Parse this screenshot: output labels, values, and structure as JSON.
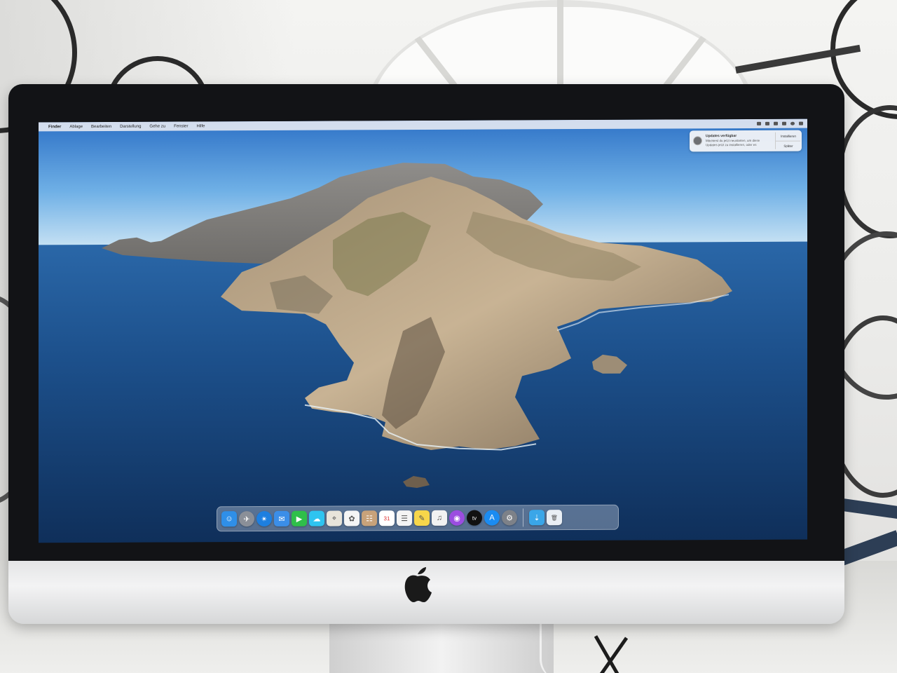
{
  "menubar": {
    "items": [
      "Finder",
      "Ablage",
      "Bearbeiten",
      "Darstellung",
      "Gehe zu",
      "Fenster",
      "Hilfe"
    ]
  },
  "notification": {
    "title": "Updates verfügbar",
    "body": "Möchtest du jetzt neustarten, um diese Updates jetzt zu installieren, oder es",
    "install_label": "Installieren",
    "later_label": "Später"
  },
  "dock": {
    "apps": [
      {
        "name": "finder-icon",
        "color": "#2f8fe8",
        "glyph": "☺"
      },
      {
        "name": "launchpad-icon",
        "color": "#8a8f98",
        "glyph": "✈"
      },
      {
        "name": "safari-icon",
        "color": "#1d7fe0",
        "glyph": "✴"
      },
      {
        "name": "mail-icon",
        "color": "#3b8ee8",
        "glyph": "✉"
      },
      {
        "name": "facetime-icon",
        "color": "#2fbf4a",
        "glyph": "▶"
      },
      {
        "name": "messages-icon",
        "color": "#2ec4f0",
        "glyph": "☁"
      },
      {
        "name": "maps-icon",
        "color": "#e8e4da",
        "glyph": "⌖"
      },
      {
        "name": "photos-icon",
        "color": "#f5f5f5",
        "glyph": "✿"
      },
      {
        "name": "contacts-icon",
        "color": "#c8a27a",
        "glyph": "☷"
      },
      {
        "name": "calendar-icon",
        "color": "#ffffff",
        "glyph": "31"
      },
      {
        "name": "reminders-icon",
        "color": "#f4f4f4",
        "glyph": "☰"
      },
      {
        "name": "notes-icon",
        "color": "#f7d64a",
        "glyph": "✎"
      },
      {
        "name": "music-icon",
        "color": "#f2f2f2",
        "glyph": "♫"
      },
      {
        "name": "podcasts-icon",
        "color": "#9b4de0",
        "glyph": "◉"
      },
      {
        "name": "apple-tv-icon",
        "color": "#111111",
        "glyph": "tv"
      },
      {
        "name": "app-store-icon",
        "color": "#1b8cf2",
        "glyph": "A"
      },
      {
        "name": "system-preferences-icon",
        "color": "#7d8188",
        "glyph": "⚙"
      }
    ],
    "extras": [
      {
        "name": "downloads-stack-icon",
        "color": "#3aa6e8",
        "glyph": "⇣"
      },
      {
        "name": "trash-icon",
        "color": "#e9eef4",
        "glyph": "🗑"
      }
    ]
  }
}
